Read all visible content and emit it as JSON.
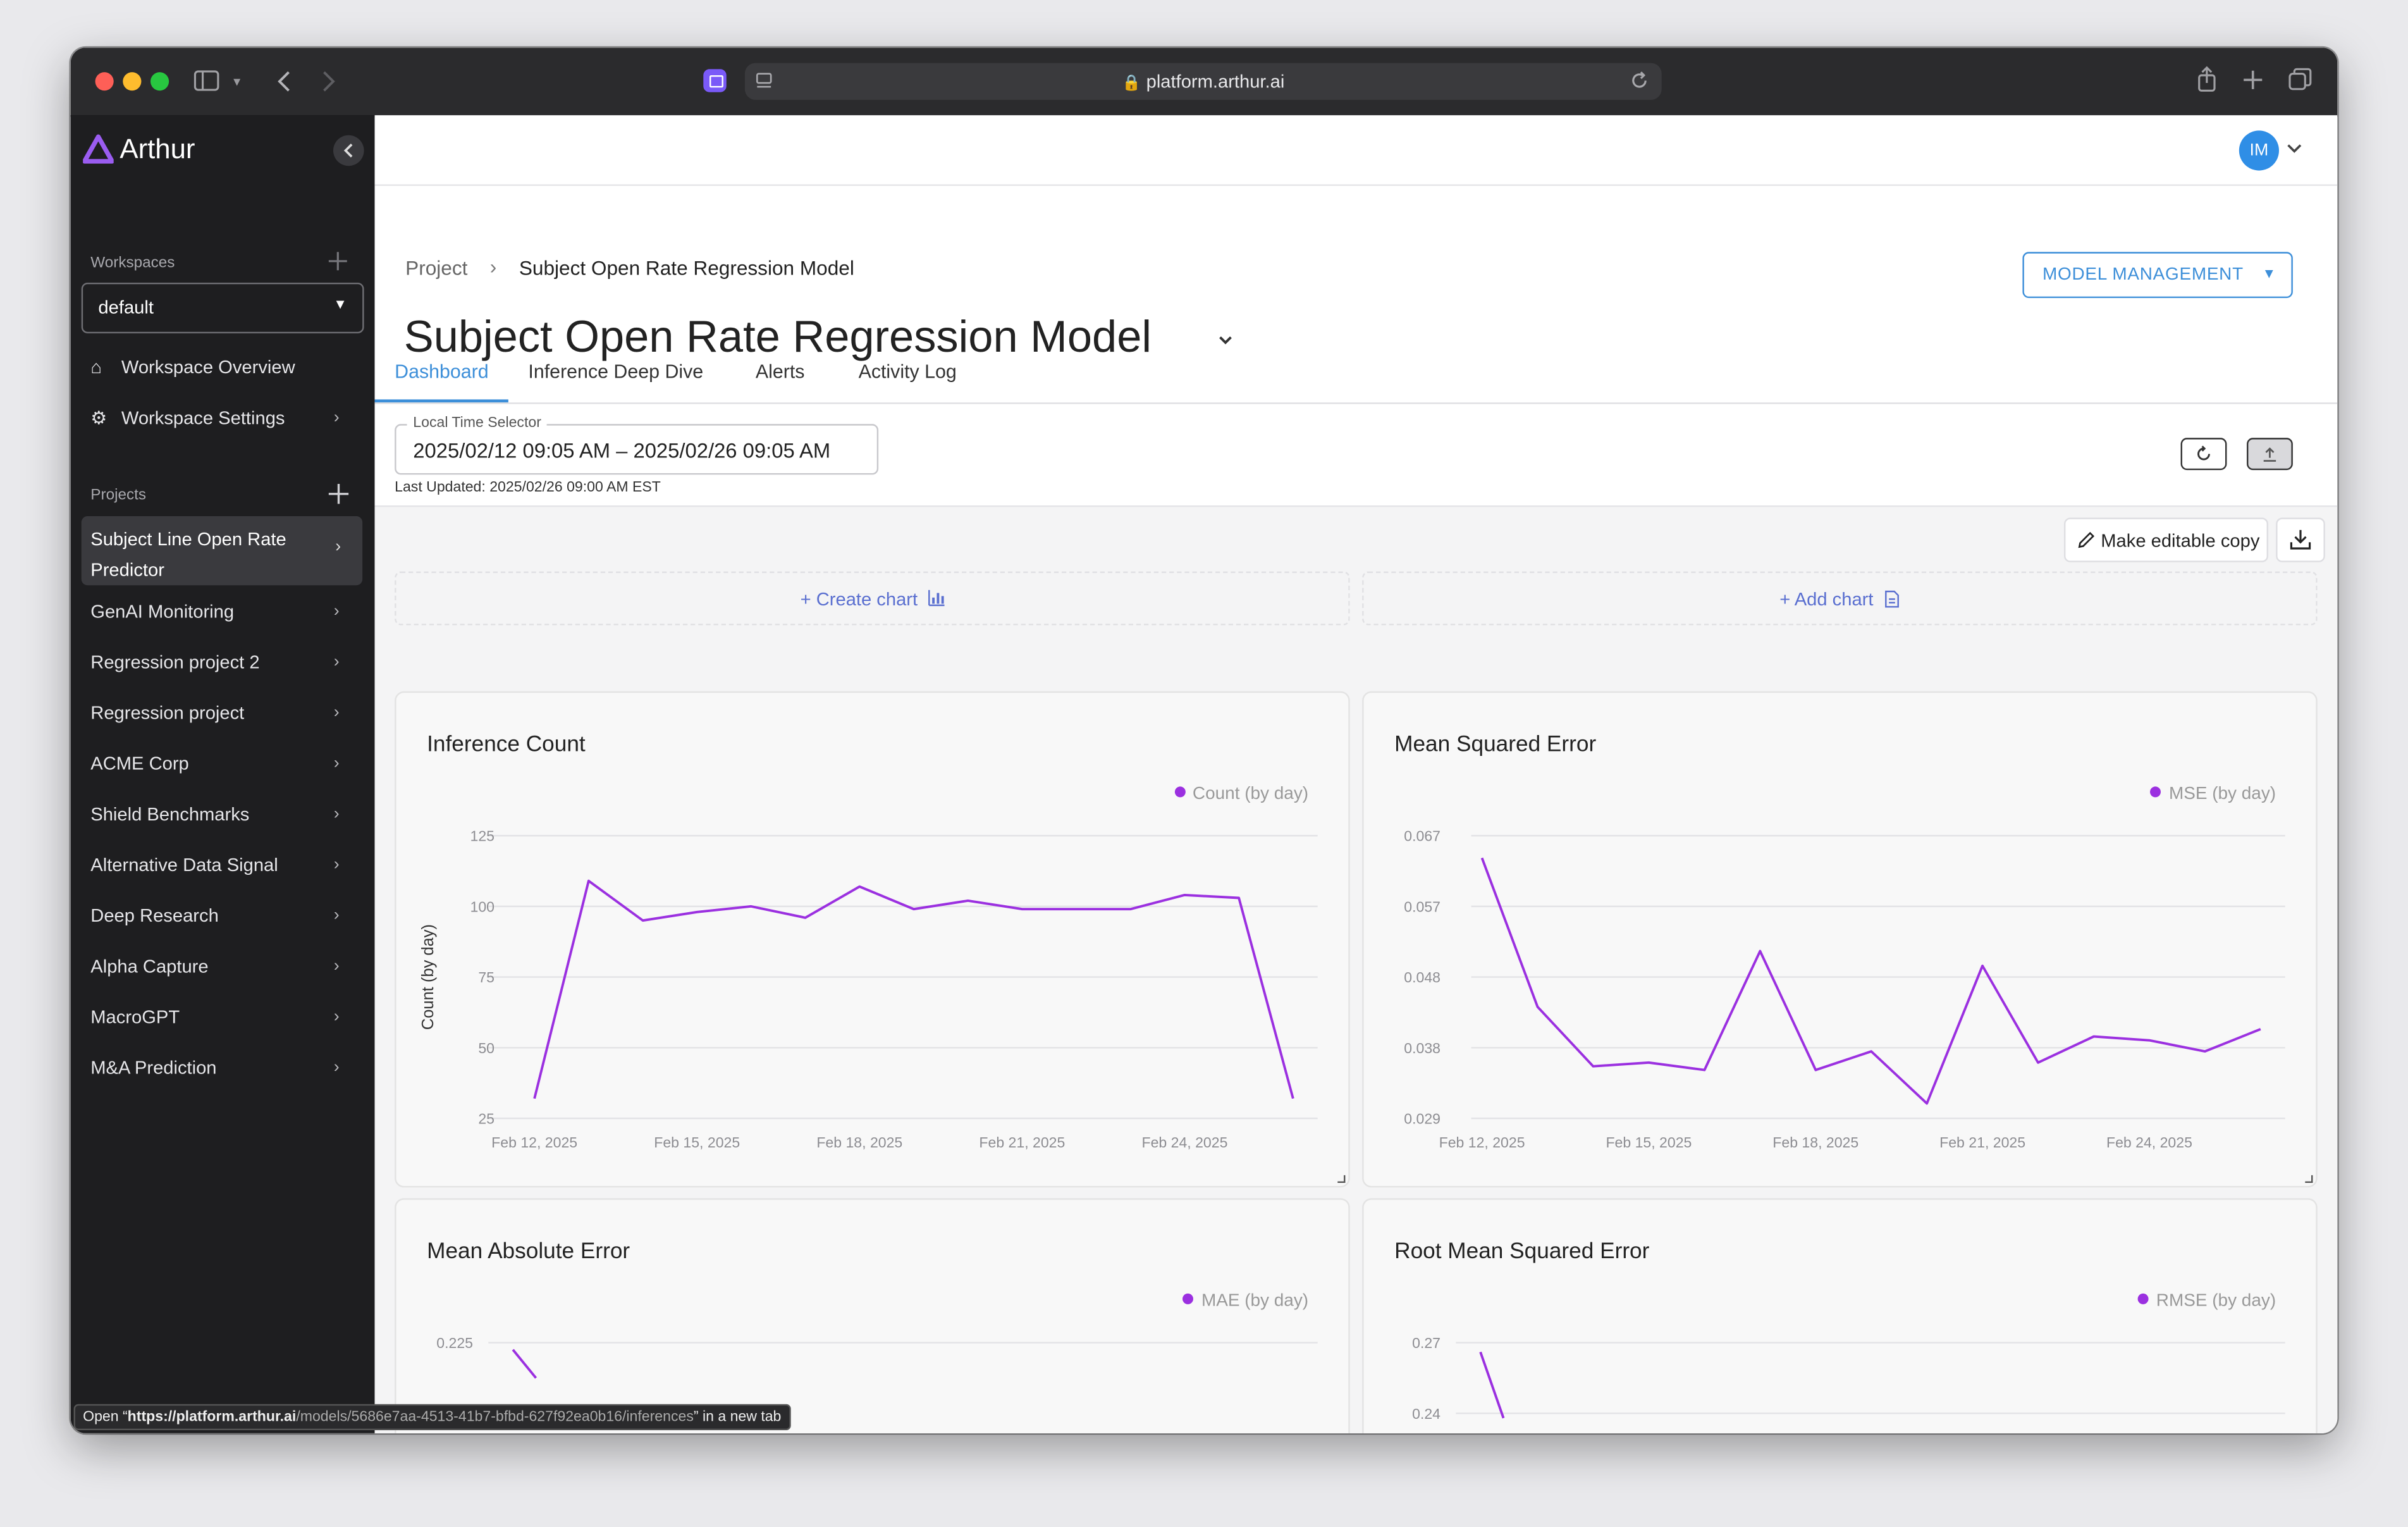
{
  "browser": {
    "url": "platform.arthur.ai",
    "status_bar": {
      "open_label": "Open “",
      "url_bold": "https://platform.arthur.ai",
      "url_path": "/models/5686e7aa-4513-41b7-bfbd-627f92ea0b16/inferences",
      "suffix": "” in a new tab"
    }
  },
  "sidebar": {
    "brand": "Arthur",
    "workspaces_label": "Workspaces",
    "workspace_select": "default",
    "nav": [
      {
        "label": "Workspace Overview",
        "icon": "home-icon"
      },
      {
        "label": "Workspace Settings",
        "icon": "gear-icon"
      }
    ],
    "projects_label": "Projects",
    "projects": [
      "Subject Line Open Rate Predictor",
      "GenAI Monitoring",
      "Regression project 2",
      "Regression project",
      "ACME Corp",
      "Shield Benchmarks",
      "Alternative Data Signal",
      "Deep Research",
      "Alpha Capture",
      "MacroGPT",
      "M&A Prediction"
    ]
  },
  "header": {
    "avatar_initials": "IM",
    "breadcrumb": {
      "root": "Project",
      "current": "Subject Open Rate Regression Model"
    },
    "title": "Subject Open Rate Regression Model",
    "model_management_button": "MODEL MANAGEMENT",
    "tabs": [
      "Dashboard",
      "Inference Deep Dive",
      "Alerts",
      "Activity Log"
    ],
    "active_tab": "Dashboard"
  },
  "time_selector": {
    "label": "Local Time Selector",
    "value": "2025/02/12 09:05 AM – 2025/02/26 09:05 AM",
    "last_updated": "Last Updated: 2025/02/26 09:00 AM EST"
  },
  "dashboard": {
    "make_editable_copy": "Make editable copy",
    "create_chart": "+ Create chart",
    "add_chart": "+ Add chart"
  },
  "colors": {
    "accent": "#3d8fd9",
    "series": "#9b30e0",
    "sidebar": "#1e1e20",
    "brand": "#8e54e9"
  },
  "chart_data": [
    {
      "type": "line",
      "title": "Inference Count",
      "ylabel": "Count (by day)",
      "series_name": "Count (by day)",
      "ylim": [
        25,
        125
      ],
      "yticks": [
        "125",
        "100",
        "75",
        "50",
        "25"
      ],
      "xticks": [
        "Feb 12, 2025",
        "Feb 15, 2025",
        "Feb 18, 2025",
        "Feb 21, 2025",
        "Feb 24, 2025"
      ],
      "x": [
        0,
        1,
        2,
        3,
        4,
        5,
        6,
        7,
        8,
        9,
        10,
        11,
        12,
        13,
        14
      ],
      "values": [
        32,
        109,
        95,
        98,
        100,
        96,
        107,
        99,
        102,
        99,
        99,
        99,
        104,
        103,
        32
      ]
    },
    {
      "type": "line",
      "title": "Mean Squared Error",
      "series_name": "MSE (by day)",
      "ylim": [
        0.029,
        0.067
      ],
      "yticks": [
        "0.067",
        "0.057",
        "0.048",
        "0.038",
        "0.029"
      ],
      "xticks": [
        "Feb 12, 2025",
        "Feb 15, 2025",
        "Feb 18, 2025",
        "Feb 21, 2025",
        "Feb 24, 2025"
      ],
      "x": [
        0,
        1,
        2,
        3,
        4,
        5,
        6,
        7,
        8,
        9,
        10,
        11,
        12,
        13,
        14
      ],
      "values": [
        0.064,
        0.044,
        0.036,
        0.0365,
        0.0355,
        0.0515,
        0.0355,
        0.038,
        0.031,
        0.0495,
        0.0365,
        0.04,
        0.0395,
        0.038,
        0.041
      ]
    },
    {
      "type": "line",
      "title": "Mean Absolute Error",
      "series_name": "MAE (by day)",
      "yticks": [
        "0.225"
      ],
      "x": [
        0,
        0.1
      ],
      "values": [
        0.222,
        0.21
      ]
    },
    {
      "type": "line",
      "title": "Root Mean Squared Error",
      "series_name": "RMSE (by day)",
      "yticks": [
        "0.27",
        "0.24"
      ],
      "x": [
        0,
        0.1
      ],
      "values": [
        0.266,
        0.238
      ]
    }
  ]
}
